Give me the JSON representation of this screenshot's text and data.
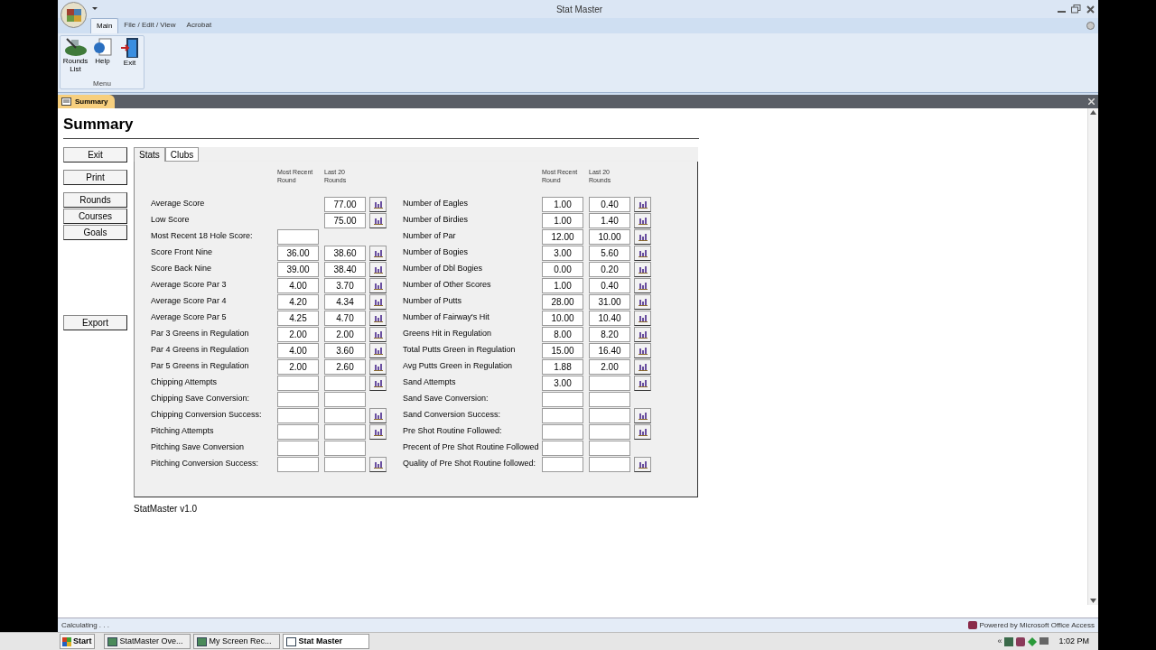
{
  "window": {
    "title": "Stat Master"
  },
  "ribbon": {
    "tabs": [
      {
        "label": "Main",
        "selected": true
      },
      {
        "label": "File / Edit / View",
        "selected": false
      },
      {
        "label": "Acrobat",
        "selected": false
      }
    ],
    "group": {
      "label": "Menu",
      "buttons": [
        {
          "label": "Rounds List",
          "kind": "rounds"
        },
        {
          "label": "Help",
          "kind": "help"
        },
        {
          "label": "Exit",
          "kind": "exit"
        }
      ]
    }
  },
  "document_tabs": [
    {
      "label": "Summary",
      "selected": true
    }
  ],
  "form": {
    "title": "Summary",
    "button_groups": [
      {
        "buttons": [
          "Exit"
        ]
      },
      {
        "buttons": [
          "Print"
        ]
      },
      {
        "buttons": [
          "Rounds",
          "Courses",
          "Goals"
        ]
      },
      {
        "buttons": [
          "Export"
        ]
      }
    ],
    "tabs": [
      {
        "label": "Stats",
        "selected": true
      },
      {
        "label": "Clubs",
        "selected": false
      }
    ],
    "headers": [
      "Most Recent Round",
      "Last 20 Rounds",
      "Most Recent Round",
      "Last 20 Rounds"
    ],
    "left_rows": [
      {
        "label": "Average Score",
        "recent": {
          "kind": "none"
        },
        "last20": {
          "kind": "field",
          "value": "77.00"
        },
        "chart_button": true
      },
      {
        "label": "Low Score",
        "recent": {
          "kind": "none"
        },
        "last20": {
          "kind": "field",
          "value": "75.00"
        },
        "chart_button": true
      },
      {
        "label": "Most Recent 18 Hole Score:",
        "recent": {
          "kind": "field"
        },
        "last20": {
          "kind": "none"
        },
        "chart_button": false
      },
      {
        "label": "Score Front Nine",
        "recent": {
          "kind": "field",
          "value": "36.00"
        },
        "last20": {
          "kind": "field",
          "value": "38.60"
        },
        "chart_button": true
      },
      {
        "label": "Score Back Nine",
        "recent": {
          "kind": "field",
          "value": "39.00"
        },
        "last20": {
          "kind": "field",
          "value": "38.40"
        },
        "chart_button": true
      },
      {
        "label": "Average Score Par 3",
        "recent": {
          "kind": "field",
          "value": "4.00"
        },
        "last20": {
          "kind": "field",
          "value": "3.70"
        },
        "chart_button": true
      },
      {
        "label": "Average Score Par 4",
        "recent": {
          "kind": "field",
          "value": "4.20"
        },
        "last20": {
          "kind": "field",
          "value": "4.34"
        },
        "chart_button": true
      },
      {
        "label": "Average Score Par 5",
        "recent": {
          "kind": "field",
          "value": "4.25"
        },
        "last20": {
          "kind": "field",
          "value": "4.70"
        },
        "chart_button": true
      },
      {
        "label": "Par 3 Greens in Regulation",
        "recent": {
          "kind": "field",
          "value": "2.00"
        },
        "last20": {
          "kind": "field",
          "value": "2.00"
        },
        "chart_button": true
      },
      {
        "label": "Par 4 Greens in Regulation",
        "recent": {
          "kind": "field",
          "value": "4.00"
        },
        "last20": {
          "kind": "field",
          "value": "3.60"
        },
        "chart_button": true
      },
      {
        "label": "Par 5 Greens in Regulation",
        "recent": {
          "kind": "field",
          "value": "2.00"
        },
        "last20": {
          "kind": "field",
          "value": "2.60"
        },
        "chart_button": true
      },
      {
        "label": "Chipping Attempts",
        "recent": {
          "kind": "field"
        },
        "last20": {
          "kind": "field"
        },
        "chart_button": true
      },
      {
        "label": "Chipping Save Conversion:",
        "recent": {
          "kind": "field"
        },
        "last20": {
          "kind": "field"
        },
        "chart_button": false
      },
      {
        "label": "Chipping Conversion Success:",
        "recent": {
          "kind": "field"
        },
        "last20": {
          "kind": "field"
        },
        "chart_button": true
      },
      {
        "label": "Pitching Attempts",
        "recent": {
          "kind": "field"
        },
        "last20": {
          "kind": "field"
        },
        "chart_button": true
      },
      {
        "label": "Pitching Save Conversion",
        "recent": {
          "kind": "field"
        },
        "last20": {
          "kind": "field"
        },
        "chart_button": false
      },
      {
        "label": "Pitching Conversion Success:",
        "recent": {
          "kind": "field"
        },
        "last20": {
          "kind": "field"
        },
        "chart_button": true
      }
    ],
    "right_rows": [
      {
        "label": "Number of Eagles",
        "recent": {
          "kind": "field",
          "value": "1.00"
        },
        "last20": {
          "kind": "field",
          "value": "0.40"
        },
        "chart_button": true
      },
      {
        "label": "Number of Birdies",
        "recent": {
          "kind": "field",
          "value": "1.00"
        },
        "last20": {
          "kind": "field",
          "value": "1.40"
        },
        "chart_button": true
      },
      {
        "label": "Number of Par",
        "recent": {
          "kind": "field",
          "value": "12.00"
        },
        "last20": {
          "kind": "field",
          "value": "10.00"
        },
        "chart_button": true
      },
      {
        "label": "Number of Bogies",
        "recent": {
          "kind": "field",
          "value": "3.00"
        },
        "last20": {
          "kind": "field",
          "value": "5.60"
        },
        "chart_button": true
      },
      {
        "label": "Number of Dbl Bogies",
        "recent": {
          "kind": "field",
          "value": "0.00"
        },
        "last20": {
          "kind": "field",
          "value": "0.20"
        },
        "chart_button": true
      },
      {
        "label": "Number of Other Scores",
        "recent": {
          "kind": "field",
          "value": "1.00"
        },
        "last20": {
          "kind": "field",
          "value": "0.40"
        },
        "chart_button": true
      },
      {
        "label": "Number of Putts",
        "recent": {
          "kind": "field",
          "value": "28.00"
        },
        "last20": {
          "kind": "field",
          "value": "31.00"
        },
        "chart_button": true
      },
      {
        "label": "Number of Fairway's Hit",
        "recent": {
          "kind": "field",
          "value": "10.00"
        },
        "last20": {
          "kind": "field",
          "value": "10.40"
        },
        "chart_button": true
      },
      {
        "label": "Greens Hit in Regulation",
        "recent": {
          "kind": "field",
          "value": "8.00"
        },
        "last20": {
          "kind": "field",
          "value": "8.20"
        },
        "chart_button": true
      },
      {
        "label": "Total Putts Green in Regulation",
        "recent": {
          "kind": "field",
          "value": "15.00"
        },
        "last20": {
          "kind": "field",
          "value": "16.40"
        },
        "chart_button": true
      },
      {
        "label": "Avg Putts Green in Regulation",
        "recent": {
          "kind": "field",
          "value": "1.88"
        },
        "last20": {
          "kind": "field",
          "value": "2.00"
        },
        "chart_button": true
      },
      {
        "label": "Sand Attempts",
        "recent": {
          "kind": "field",
          "value": "3.00"
        },
        "last20": {
          "kind": "field"
        },
        "chart_button": true
      },
      {
        "label": "Sand Save Conversion:",
        "recent": {
          "kind": "field"
        },
        "last20": {
          "kind": "field"
        },
        "chart_button": false
      },
      {
        "label": "Sand Conversion Success:",
        "recent": {
          "kind": "field"
        },
        "last20": {
          "kind": "field"
        },
        "chart_button": true
      },
      {
        "label": "Pre Shot Routine Followed:",
        "recent": {
          "kind": "field"
        },
        "last20": {
          "kind": "field"
        },
        "chart_button": true
      },
      {
        "label": "Precent of Pre Shot Routine Followed",
        "recent": {
          "kind": "field"
        },
        "last20": {
          "kind": "field"
        },
        "chart_button": false
      },
      {
        "label": "Quality of Pre Shot Routine followed:",
        "recent": {
          "kind": "field"
        },
        "last20": {
          "kind": "field"
        },
        "chart_button": true
      }
    ],
    "version": "StatMaster v1.0"
  },
  "status_bar": {
    "text": "Calculating . . .",
    "brand": "Powered by Microsoft Office Access"
  },
  "taskbar": {
    "start": "Start",
    "items": [
      {
        "label": "StatMaster Ove...",
        "selected": false
      },
      {
        "label": "My Screen Rec...",
        "selected": false
      },
      {
        "label": "Stat Master",
        "selected": true
      }
    ],
    "tray_toggle": "«",
    "clock": "1:02 PM"
  }
}
